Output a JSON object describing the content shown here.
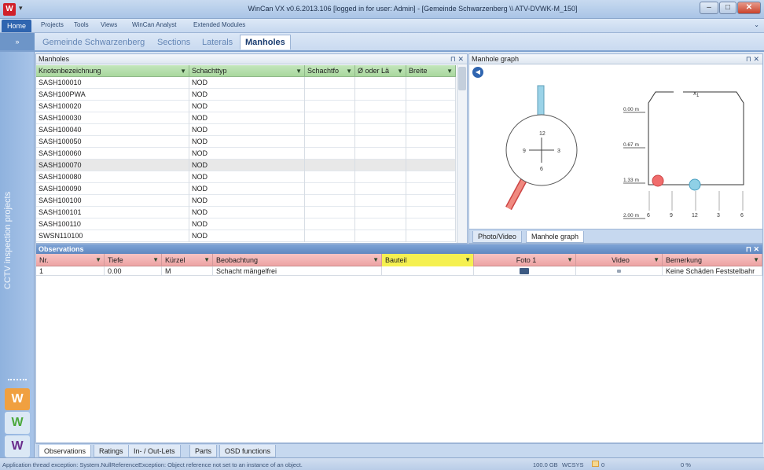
{
  "window": {
    "title": "WinCan VX v0.6.2013.106 [logged in for user: Admin] - [Gemeinde Schwarzenberg \\\\ ATV-DVWK-M_150]",
    "quick_access": "▾",
    "controls": {
      "minimize": "–",
      "maximize": "□",
      "close": "✕"
    }
  },
  "ribbon": {
    "tabs": [
      "Home",
      "Projects",
      "Tools",
      "Views",
      "WinCan Analyst",
      "Extended Modules"
    ],
    "minimize_icon": "chevron-down-icon",
    "minimize_glyph": "⌄"
  },
  "doc_tabs": {
    "collapse": "»",
    "items": [
      "Gemeinde Schwarzenberg",
      "Sections",
      "Laterals",
      "Manholes"
    ],
    "active": "Manholes"
  },
  "sidebar": {
    "label": "CCTV inspection projects",
    "icons": [
      "wincan-orange-logo-icon",
      "wincan-green-logo-icon",
      "wincan-purple-logo-icon"
    ],
    "icon_glyph": "W"
  },
  "manholes": {
    "title": "Manholes",
    "pin": "⊓ ✕",
    "columns": [
      "Knotenbezeichnung",
      "Schachttyp",
      "Schachtfo",
      "Ø oder Lä",
      "Breite"
    ],
    "filter_glyph": "▼",
    "rows": [
      [
        "SASH100010",
        "NOD"
      ],
      [
        "SASH100PWA",
        "NOD"
      ],
      [
        "SASH100020",
        "NOD"
      ],
      [
        "SASH100030",
        "NOD"
      ],
      [
        "SASH100040",
        "NOD"
      ],
      [
        "SASH100050",
        "NOD"
      ],
      [
        "SASH100060",
        "NOD"
      ],
      [
        "SASH100070",
        "NOD"
      ],
      [
        "SASH100080",
        "NOD"
      ],
      [
        "SASH100090",
        "NOD"
      ],
      [
        "SASH100100",
        "NOD"
      ],
      [
        "SASH100101",
        "NOD"
      ],
      [
        "SASH100110",
        "NOD"
      ],
      [
        "SWSN110100",
        "NOD"
      ]
    ],
    "selected_row": "SASH100070"
  },
  "graph": {
    "title": "Manhole graph",
    "pin": "⊓ ✕",
    "back_glyph": "◀",
    "clock_labels": {
      "top": "12",
      "right": "3",
      "bottom": "6",
      "left": "9"
    },
    "depth_labels": [
      "0.00 m",
      "0.67 m",
      "1.33 m",
      "2.00 m"
    ],
    "x_label": "x",
    "x_subscript": "1",
    "axis_labels": [
      "6",
      "9",
      "12",
      "3",
      "6"
    ],
    "pipe_colors": {
      "inlet": "#8fd0e6",
      "outlet": "#f06c6c"
    },
    "tabs": [
      "Photo/Video",
      "Manhole graph"
    ],
    "active_tab": "Manhole graph"
  },
  "observations": {
    "title": "Observations",
    "pin": "⊓ ✕",
    "columns": [
      "Nr.",
      "Tiefe",
      "Kürzel",
      "Beobachtung",
      "Bauteil",
      "Foto 1",
      "Video",
      "Bemerkung"
    ],
    "highlight_column": "Bauteil",
    "filter_glyph": "▼",
    "row": {
      "nr": "1",
      "tiefe": "0.00",
      "kuerzel": "M",
      "beobachtung": "Schacht mängelfrei",
      "bauteil": "",
      "foto_icon": "camera-icon",
      "video_icon": "video-icon",
      "bemerkung": "Keine Schäden Feststelbahr"
    }
  },
  "bottom_tabs": [
    "Observations",
    "Ratings",
    "In- / Out-Lets",
    "Parts",
    "OSD functions"
  ],
  "active_bottom_tab": "Observations",
  "status": {
    "message": "Application thread exception: System.NullReferenceException: Object reference not set to an instance of an object.",
    "disk": "100.0 GB",
    "coord": "WCSYS",
    "count": "0",
    "progress": "0 %"
  }
}
